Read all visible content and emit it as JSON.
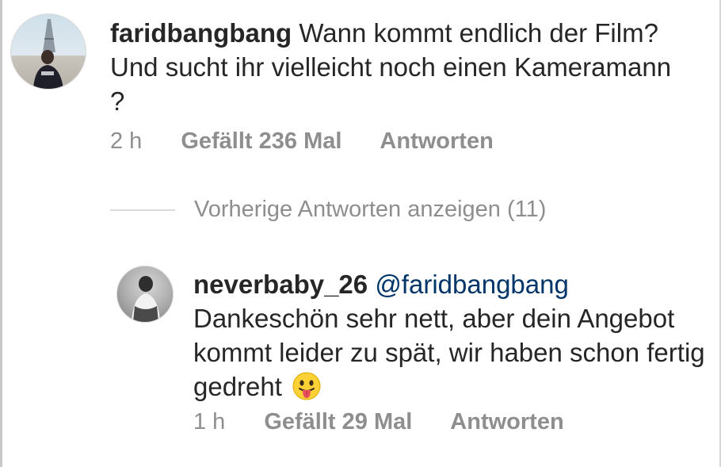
{
  "main_comment": {
    "username": "faridbangbang",
    "text": "Wann kommt endlich der Film? Und sucht ihr vielleicht noch einen Kameramann ?",
    "time": "2 h",
    "likes": "Gefällt 236 Mal",
    "reply": "Antworten"
  },
  "view_replies": {
    "label": "Vorherige Antworten anzeigen (11)"
  },
  "reply_comment": {
    "username": "neverbaby_26",
    "mention": "@faridbangbang",
    "text": "Dankeschön sehr nett, aber dein Angebot kommt leider zu spät, wir haben schon fertig gedreht",
    "emoji": "tongue-out-emoji",
    "time": "1 h",
    "likes": "Gefällt 29 Mal",
    "reply": "Antworten"
  }
}
